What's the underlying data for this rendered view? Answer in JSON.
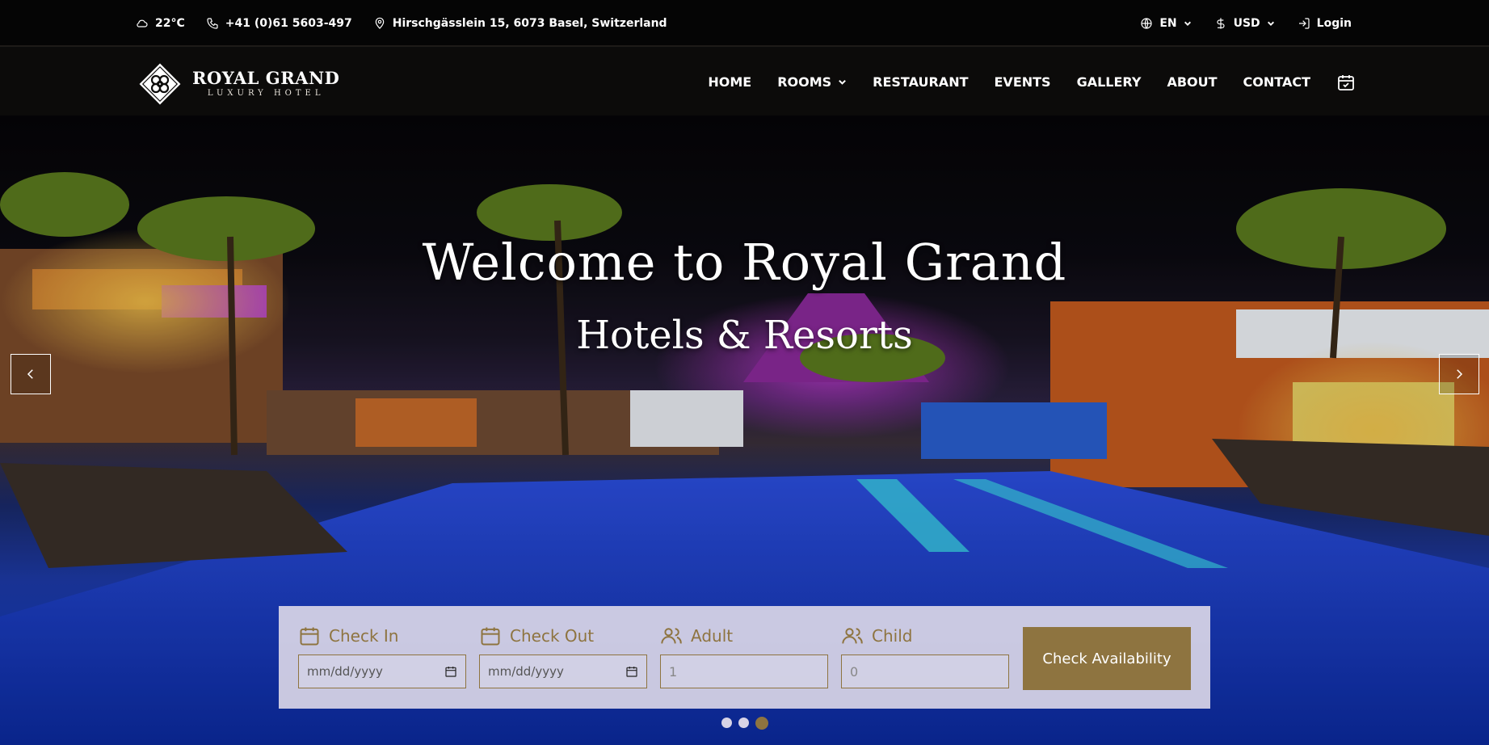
{
  "topbar": {
    "weather": {
      "icon": "cloud-icon",
      "value": "22°C"
    },
    "phone": {
      "icon": "phone-icon",
      "value": "+41 (0)61 5603-497"
    },
    "address": {
      "icon": "map-pin-icon",
      "value": "Hirschgässlein 15, 6073 Basel, Switzerland"
    },
    "language": {
      "icon": "globe-icon",
      "value": "EN"
    },
    "currency": {
      "icon": "dollar-icon",
      "value": "USD"
    },
    "login": {
      "icon": "login-icon",
      "label": "Login"
    }
  },
  "brand": {
    "name": "ROYAL GRAND",
    "tagline": "LUXURY HOTEL"
  },
  "nav": {
    "items": [
      {
        "label": "HOME"
      },
      {
        "label": "ROOMS",
        "dropdown": true
      },
      {
        "label": "RESTAURANT"
      },
      {
        "label": "EVENTS"
      },
      {
        "label": "GALLERY"
      },
      {
        "label": "ABOUT"
      },
      {
        "label": "CONTACT"
      }
    ],
    "booking_icon": "calendar-check-icon"
  },
  "hero": {
    "title": "Welcome to Royal Grand",
    "subtitle": "Hotels & Resorts",
    "slides_total": 3,
    "active_slide": 3
  },
  "booking": {
    "check_in": {
      "label": "Check In",
      "placeholder": "mm/dd/yyyy",
      "icon": "calendar-icon"
    },
    "check_out": {
      "label": "Check Out",
      "placeholder": "mm/dd/yyyy",
      "icon": "calendar-icon"
    },
    "adult": {
      "label": "Adult",
      "value": "1",
      "icon": "users-icon"
    },
    "child": {
      "label": "Child",
      "value": "0",
      "icon": "users-icon"
    },
    "submit_label": "Check Availability"
  },
  "colors": {
    "accent": "#8e7440",
    "topbar_bg": "#050505",
    "nav_bg": "#0c0b0a"
  }
}
